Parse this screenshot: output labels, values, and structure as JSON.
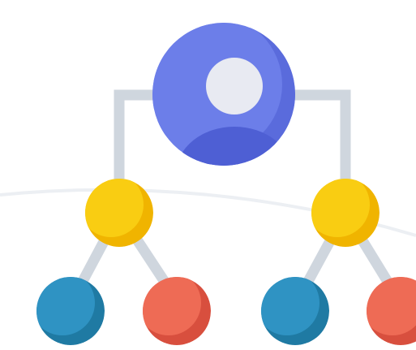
{
  "colors": {
    "background": "#ffffff",
    "connector": "#cfd6de",
    "arc": "#eceff3",
    "root_main": "#6c7ee9",
    "root_shade": "#5a6bdc",
    "root_person": "#e8eaf2",
    "root_person_body": "#4e5fd4",
    "middle_main": "#f9cd12",
    "middle_shade": "#f0b400",
    "leaf_blue_main": "#2f93c3",
    "leaf_blue_shade": "#1f7aa3",
    "leaf_red_main": "#ee6b55",
    "leaf_red_shade": "#d84f3e"
  },
  "diagram": {
    "type": "hierarchy",
    "root": {
      "icon": "user-avatar-icon",
      "children": [
        {
          "icon": "yellow-node-icon",
          "children": [
            {
              "icon": "blue-node-icon"
            },
            {
              "icon": "red-node-icon"
            }
          ]
        },
        {
          "icon": "yellow-node-icon",
          "children": [
            {
              "icon": "blue-node-icon"
            },
            {
              "icon": "red-node-icon"
            }
          ]
        }
      ]
    }
  }
}
